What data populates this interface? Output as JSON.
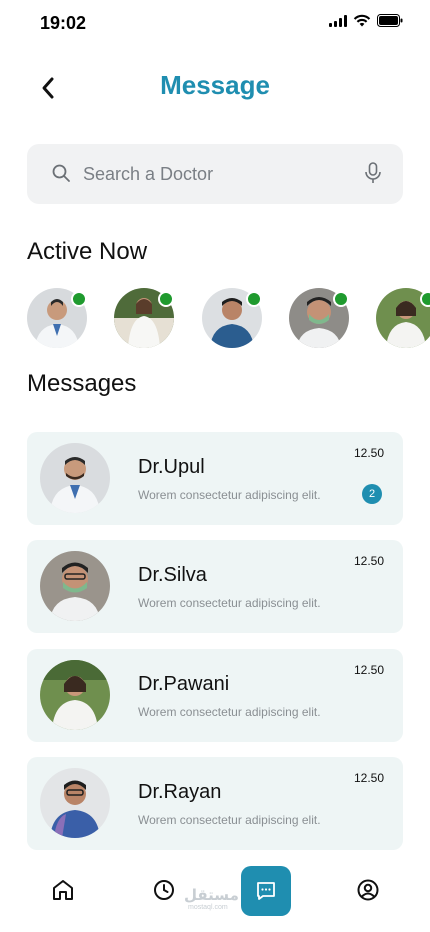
{
  "status_bar": {
    "time": "19:02"
  },
  "header": {
    "title": "Message"
  },
  "search": {
    "placeholder": "Search a Doctor"
  },
  "active_section": {
    "title": "Active Now"
  },
  "messages_section": {
    "title": "Messages"
  },
  "messages": [
    {
      "name": "Dr.Upul",
      "preview": "Worem consectetur adipiscing elit.",
      "time": "12.50",
      "unread": "2"
    },
    {
      "name": "Dr.Silva",
      "preview": "Worem consectetur adipiscing elit.",
      "time": "12.50"
    },
    {
      "name": "Dr.Pawani",
      "preview": "Worem consectetur adipiscing elit.",
      "time": "12.50"
    },
    {
      "name": "Dr.Rayan",
      "preview": "Worem consectetur adipiscing elit.",
      "time": "12.50"
    }
  ],
  "colors": {
    "accent": "#1f8eb0",
    "online": "#1f9a2e",
    "card_bg": "#eef5f5",
    "search_bg": "#f1f2f3"
  },
  "nav": {
    "items": [
      "home-icon",
      "clock-icon",
      "chat-icon",
      "profile-icon"
    ],
    "active": "chat-icon"
  },
  "watermark": {
    "text": "مستقل",
    "sub": "mostaql.com"
  }
}
